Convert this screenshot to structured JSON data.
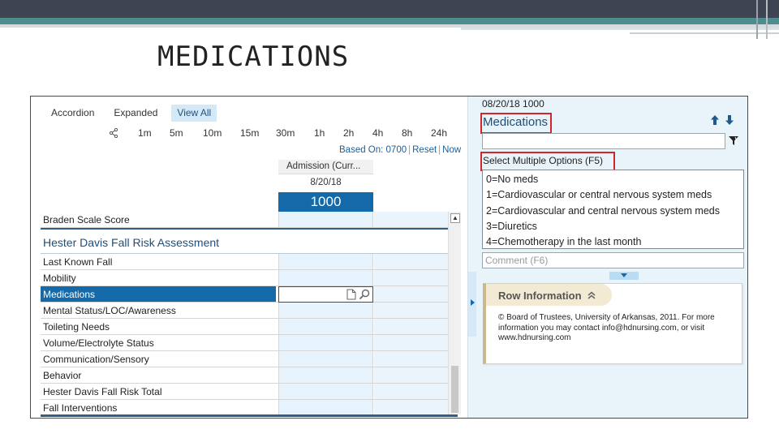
{
  "slide": {
    "title": "MEDICATIONS"
  },
  "view_tabs": [
    {
      "label": "Accordion",
      "active": false
    },
    {
      "label": "Expanded",
      "active": false
    },
    {
      "label": "View All",
      "active": true
    }
  ],
  "time_intervals": [
    "1m",
    "5m",
    "10m",
    "15m",
    "30m",
    "1h",
    "2h",
    "4h",
    "8h",
    "24h"
  ],
  "based_on": {
    "label": "Based On: 0700",
    "reset": "Reset",
    "now": "Now"
  },
  "column": {
    "header": "Admission (Curr...",
    "date": "8/20/18",
    "time": "1000"
  },
  "grid_rows": [
    {
      "label": "Braden Scale Score",
      "type": "row"
    },
    {
      "label": "Hester Davis Fall Risk Assessment",
      "type": "section"
    },
    {
      "label": "Last Known Fall",
      "type": "row"
    },
    {
      "label": "Mobility",
      "type": "row"
    },
    {
      "label": "Medications",
      "type": "selected"
    },
    {
      "label": "Mental Status/LOC/Awareness",
      "type": "row"
    },
    {
      "label": "Toileting Needs",
      "type": "row"
    },
    {
      "label": "Volume/Electrolyte Status",
      "type": "row"
    },
    {
      "label": "Communication/Sensory",
      "type": "row"
    },
    {
      "label": "Behavior",
      "type": "row"
    },
    {
      "label": "Hester Davis Fall Risk Total",
      "type": "row"
    },
    {
      "label": "Fall Interventions",
      "type": "row"
    }
  ],
  "detail": {
    "datetime": "08/20/18 1000",
    "title": "Medications",
    "select_label": "Select Multiple Options  (F5)",
    "options": [
      "0=No meds",
      "1=Cardiovascular or central nervous system meds",
      "2=Cardiovascular and central nervous system meds",
      "3=Diuretics",
      "4=Chemotherapy in the last month"
    ],
    "comment_placeholder": "Comment (F6)"
  },
  "row_info": {
    "title": "Row Information",
    "text": "© Board of Trustees, University of Arkansas, 2011. For more information you may contact info@hdnursing.com, or visit www.hdnursing.com"
  },
  "colors": {
    "selected": "#1469a8",
    "highlight_box": "#d0262b",
    "header_dark": "#3f4453",
    "header_teal": "#4f8c90"
  }
}
